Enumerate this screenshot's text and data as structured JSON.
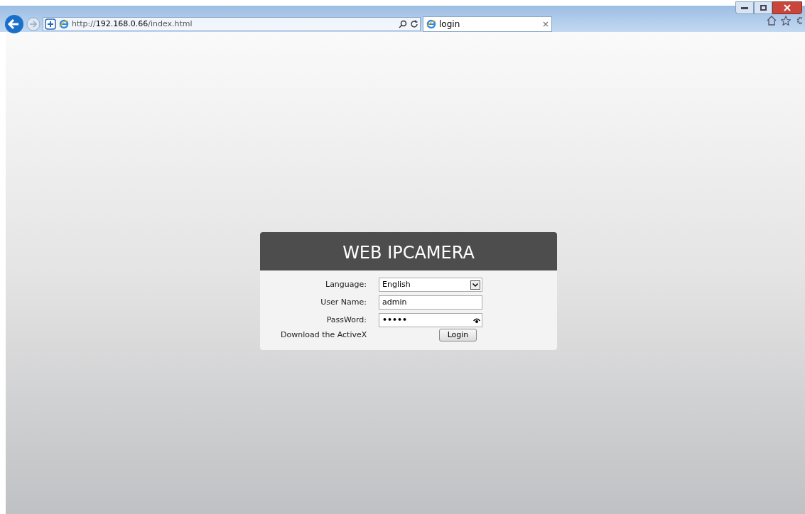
{
  "browser": {
    "address_scheme": "http://",
    "address_host": "192.168.0.66",
    "address_path": "/index.html",
    "tab_title": "login"
  },
  "login": {
    "title": "WEB IPCAMERA",
    "fields": [
      {
        "kind": "select",
        "label": "Language:",
        "value": "English"
      },
      {
        "kind": "text",
        "label": "User Name:",
        "value": "admin"
      },
      {
        "kind": "password",
        "label": "PassWord:",
        "value": "•••••"
      }
    ],
    "download_link": "Download the ActiveX",
    "button": "Login"
  }
}
